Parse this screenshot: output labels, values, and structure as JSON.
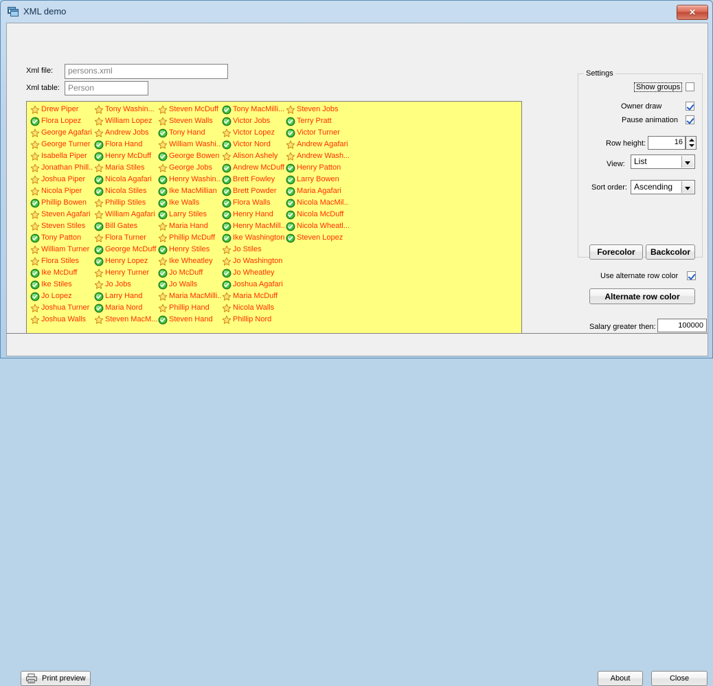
{
  "window": {
    "title": "XML demo",
    "icon": "window-icon",
    "close_label": "✕"
  },
  "form": {
    "xml_file_label": "Xml file:",
    "xml_file_value": "persons.xml",
    "xml_table_label": "Xml table:",
    "xml_table_value": "Person"
  },
  "settings": {
    "title": "Settings",
    "show_groups_label": "Show groups",
    "show_groups_checked": false,
    "owner_draw_label": "Owner draw",
    "owner_draw_checked": true,
    "pause_animation_label": "Pause animation",
    "pause_animation_checked": true,
    "row_height_label": "Row height:",
    "row_height_value": "16",
    "view_label": "View:",
    "view_value": "List",
    "sort_order_label": "Sort order:",
    "sort_order_value": "Ascending",
    "forecolor_label": "Forecolor",
    "backcolor_label": "Backcolor",
    "use_alternate_row_color_label": "Use alternate row color",
    "use_alternate_row_color_checked": true,
    "alternate_row_color_label": "Alternate row color"
  },
  "salary": {
    "label": "Salary greater then:",
    "value": "100000"
  },
  "buttons": {
    "print_preview": "Print preview",
    "about": "About",
    "close": "Close"
  },
  "colors": {
    "list_background": "#ffff80",
    "list_text": "#ff2d00",
    "title_text": "#10304e",
    "close_button": "#c24a35"
  },
  "listview": {
    "columns": [
      [
        {
          "icon": "star-icon",
          "label": "Drew Piper"
        },
        {
          "icon": "check-icon",
          "label": "Flora Lopez"
        },
        {
          "icon": "star-icon",
          "label": "George Agafari"
        },
        {
          "icon": "star-icon",
          "label": "George Turner"
        },
        {
          "icon": "star-icon",
          "label": "Isabella Piper"
        },
        {
          "icon": "star-icon",
          "label": "Jonathan Phill..."
        },
        {
          "icon": "star-icon",
          "label": "Joshua Piper"
        },
        {
          "icon": "star-icon",
          "label": "Nicola Piper"
        },
        {
          "icon": "check-icon",
          "label": "Phillip Bowen"
        },
        {
          "icon": "star-icon",
          "label": "Steven Agafari"
        },
        {
          "icon": "star-icon",
          "label": "Steven Stiles"
        },
        {
          "icon": "check-icon",
          "label": "Tony Patton"
        },
        {
          "icon": "star-icon",
          "label": "William Turner"
        },
        {
          "icon": "star-icon",
          "label": "Flora Stiles"
        },
        {
          "icon": "check-icon",
          "label": "Ike McDuff"
        },
        {
          "icon": "check-icon",
          "label": "Ike Stiles"
        },
        {
          "icon": "check-icon",
          "label": "Jo Lopez"
        },
        {
          "icon": "star-icon",
          "label": "Joshua Turner"
        },
        {
          "icon": "star-icon",
          "label": "Joshua Walls"
        }
      ],
      [
        {
          "icon": "star-icon",
          "label": "Tony Washin..."
        },
        {
          "icon": "star-icon",
          "label": "William Lopez"
        },
        {
          "icon": "star-icon",
          "label": "Andrew Jobs"
        },
        {
          "icon": "check-icon",
          "label": "Flora Hand"
        },
        {
          "icon": "check-icon",
          "label": "Henry McDuff"
        },
        {
          "icon": "star-icon",
          "label": "Maria Stiles"
        },
        {
          "icon": "check-icon",
          "label": "Nicola Agafari"
        },
        {
          "icon": "check-icon",
          "label": "Nicola Stiles"
        },
        {
          "icon": "star-icon",
          "label": "Phillip Stiles"
        },
        {
          "icon": "star-icon",
          "label": "William Agafari"
        },
        {
          "icon": "check-icon",
          "label": "Bill Gates"
        },
        {
          "icon": "star-icon",
          "label": "Flora Turner"
        },
        {
          "icon": "check-icon",
          "label": "George McDuff"
        },
        {
          "icon": "check-icon",
          "label": "Henry Lopez"
        },
        {
          "icon": "star-icon",
          "label": "Henry Turner"
        },
        {
          "icon": "star-icon",
          "label": "Jo Jobs"
        },
        {
          "icon": "check-icon",
          "label": "Larry Hand"
        },
        {
          "icon": "check-icon",
          "label": "Maria Nord"
        },
        {
          "icon": "star-icon",
          "label": "Steven MacM..."
        }
      ],
      [
        {
          "icon": "star-icon",
          "label": "Steven McDuff"
        },
        {
          "icon": "star-icon",
          "label": "Steven Walls"
        },
        {
          "icon": "check-icon",
          "label": "Tony Hand"
        },
        {
          "icon": "star-icon",
          "label": "William Washi..."
        },
        {
          "icon": "check-icon",
          "label": "George Bowen"
        },
        {
          "icon": "star-icon",
          "label": "George Jobs"
        },
        {
          "icon": "check-icon",
          "label": "Henry Washin..."
        },
        {
          "icon": "check-icon",
          "label": "Ike MacMillian"
        },
        {
          "icon": "check-icon",
          "label": "Ike Walls"
        },
        {
          "icon": "check-icon",
          "label": "Larry Stiles"
        },
        {
          "icon": "star-icon",
          "label": "Maria Hand"
        },
        {
          "icon": "star-icon",
          "label": "Phillip McDuff"
        },
        {
          "icon": "check-icon",
          "label": "Henry Stiles"
        },
        {
          "icon": "star-icon",
          "label": "Ike Wheatley"
        },
        {
          "icon": "check-icon",
          "label": "Jo McDuff"
        },
        {
          "icon": "check-icon",
          "label": "Jo Walls"
        },
        {
          "icon": "star-icon",
          "label": "Maria MacMilli..."
        },
        {
          "icon": "star-icon",
          "label": "Phillip Hand"
        },
        {
          "icon": "check-icon",
          "label": "Steven Hand"
        }
      ],
      [
        {
          "icon": "check-icon",
          "label": "Tony MacMilli..."
        },
        {
          "icon": "check-icon",
          "label": "Victor Jobs"
        },
        {
          "icon": "star-icon",
          "label": "Victor Lopez"
        },
        {
          "icon": "check-icon",
          "label": "Victor Nord"
        },
        {
          "icon": "star-icon",
          "label": "Alison Ashely"
        },
        {
          "icon": "check-icon",
          "label": "Andrew McDuff"
        },
        {
          "icon": "check-icon",
          "label": "Brett Fowley"
        },
        {
          "icon": "check-icon",
          "label": "Brett Powder"
        },
        {
          "icon": "check-icon",
          "label": "Flora Walls"
        },
        {
          "icon": "check-icon",
          "label": "Henry Hand"
        },
        {
          "icon": "check-icon",
          "label": "Henry MacMill..."
        },
        {
          "icon": "check-icon",
          "label": "Ike Washington"
        },
        {
          "icon": "star-icon",
          "label": "Jo Stiles"
        },
        {
          "icon": "star-icon",
          "label": "Jo Washington"
        },
        {
          "icon": "check-icon",
          "label": "Jo Wheatley"
        },
        {
          "icon": "check-icon",
          "label": "Joshua Agafari"
        },
        {
          "icon": "star-icon",
          "label": "Maria McDuff"
        },
        {
          "icon": "star-icon",
          "label": "Nicola Walls"
        },
        {
          "icon": "star-icon",
          "label": "Phillip Nord"
        }
      ],
      [
        {
          "icon": "star-icon",
          "label": "Steven Jobs"
        },
        {
          "icon": "check-icon",
          "label": "Terry Pratt"
        },
        {
          "icon": "check-icon",
          "label": "Victor Turner"
        },
        {
          "icon": "star-icon",
          "label": "Andrew Agafari"
        },
        {
          "icon": "star-icon",
          "label": "Andrew Wash..."
        },
        {
          "icon": "check-icon",
          "label": "Henry Patton"
        },
        {
          "icon": "check-icon",
          "label": "Larry Bowen"
        },
        {
          "icon": "check-icon",
          "label": "Maria Agafari"
        },
        {
          "icon": "check-icon",
          "label": "Nicola MacMil..."
        },
        {
          "icon": "check-icon",
          "label": "Nicola McDuff"
        },
        {
          "icon": "check-icon",
          "label": "Nicola Wheatl..."
        },
        {
          "icon": "check-icon",
          "label": "Steven Lopez"
        }
      ]
    ]
  }
}
